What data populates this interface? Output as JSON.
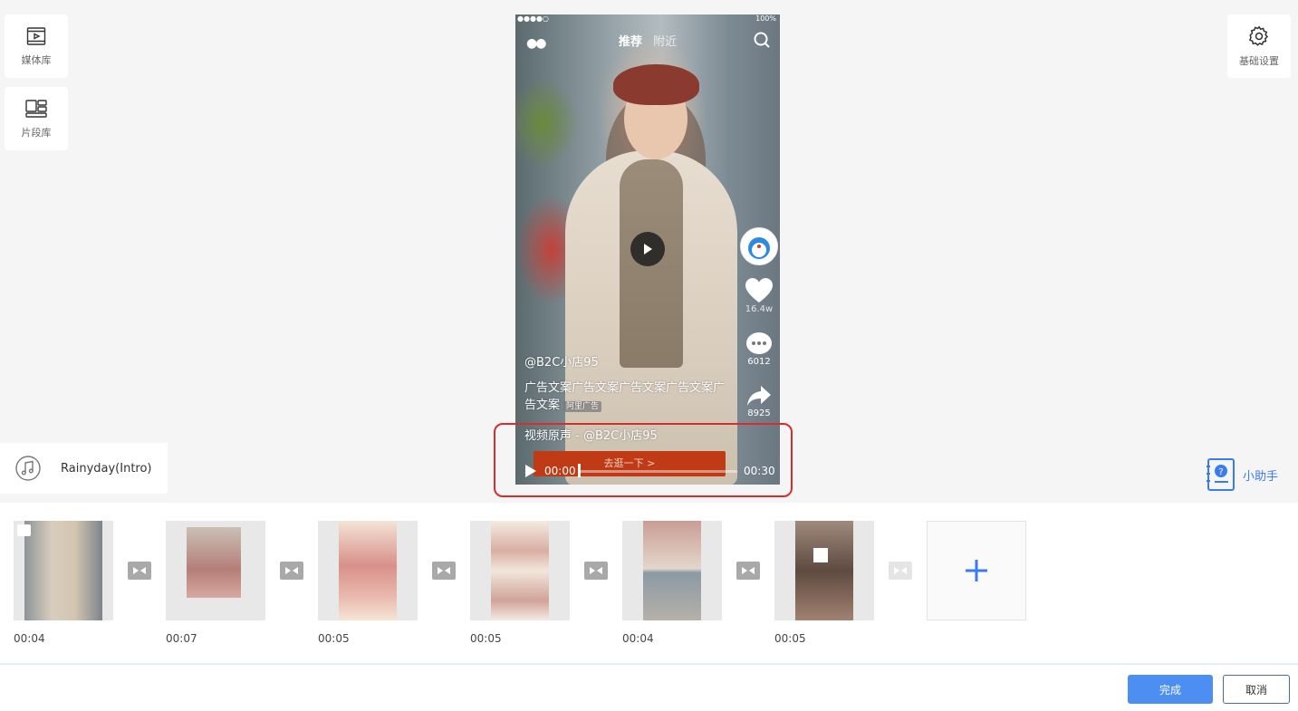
{
  "toolbar_left": {
    "media_library": "媒体库",
    "clip_library": "片段库"
  },
  "toolbar_right": {
    "basic_settings": "基础设置"
  },
  "preview": {
    "status_bar": {
      "signal": "●●●●○",
      "battery": "100%"
    },
    "tabs": {
      "active": "推荐",
      "inactive": "附近"
    },
    "stats": {
      "likes": "16.4w",
      "comments": "6012",
      "shares": "8925"
    },
    "username": "@B2C小店95",
    "ad_copy": "广告文案广告文案广告文案广告文案广告文案",
    "ad_tag": "阿里广告",
    "music": "视频原声 - @B2C小店95",
    "cta": "去逛一下 >",
    "time_current": "00:00",
    "time_total": "00:30",
    "progress": 0
  },
  "music_track": {
    "name": "Rainyday(Intro)"
  },
  "assistant": {
    "label": "小助手"
  },
  "timeline": {
    "clips": [
      {
        "duration": "00:04"
      },
      {
        "duration": "00:07"
      },
      {
        "duration": "00:05"
      },
      {
        "duration": "00:05"
      },
      {
        "duration": "00:04"
      },
      {
        "duration": "00:05"
      }
    ]
  },
  "footer": {
    "confirm": "完成",
    "cancel": "取消"
  },
  "colors": {
    "primary": "#4d8ef3",
    "highlight": "#d62d2d",
    "cta": "#c03a16"
  }
}
